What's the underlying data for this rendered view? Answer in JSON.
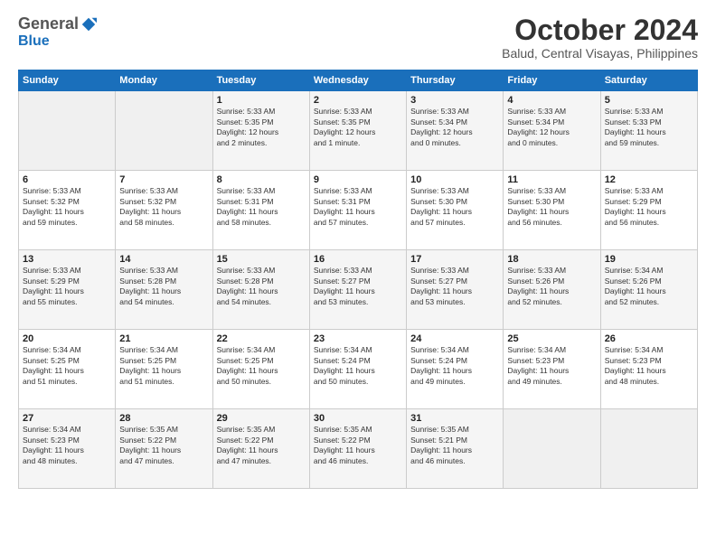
{
  "logo": {
    "general": "General",
    "blue": "Blue"
  },
  "title": "October 2024",
  "location": "Balud, Central Visayas, Philippines",
  "days_of_week": [
    "Sunday",
    "Monday",
    "Tuesday",
    "Wednesday",
    "Thursday",
    "Friday",
    "Saturday"
  ],
  "weeks": [
    [
      {
        "day": "",
        "info": ""
      },
      {
        "day": "",
        "info": ""
      },
      {
        "day": "1",
        "info": "Sunrise: 5:33 AM\nSunset: 5:35 PM\nDaylight: 12 hours\nand 2 minutes."
      },
      {
        "day": "2",
        "info": "Sunrise: 5:33 AM\nSunset: 5:35 PM\nDaylight: 12 hours\nand 1 minute."
      },
      {
        "day": "3",
        "info": "Sunrise: 5:33 AM\nSunset: 5:34 PM\nDaylight: 12 hours\nand 0 minutes."
      },
      {
        "day": "4",
        "info": "Sunrise: 5:33 AM\nSunset: 5:34 PM\nDaylight: 12 hours\nand 0 minutes."
      },
      {
        "day": "5",
        "info": "Sunrise: 5:33 AM\nSunset: 5:33 PM\nDaylight: 11 hours\nand 59 minutes."
      }
    ],
    [
      {
        "day": "6",
        "info": "Sunrise: 5:33 AM\nSunset: 5:32 PM\nDaylight: 11 hours\nand 59 minutes."
      },
      {
        "day": "7",
        "info": "Sunrise: 5:33 AM\nSunset: 5:32 PM\nDaylight: 11 hours\nand 58 minutes."
      },
      {
        "day": "8",
        "info": "Sunrise: 5:33 AM\nSunset: 5:31 PM\nDaylight: 11 hours\nand 58 minutes."
      },
      {
        "day": "9",
        "info": "Sunrise: 5:33 AM\nSunset: 5:31 PM\nDaylight: 11 hours\nand 57 minutes."
      },
      {
        "day": "10",
        "info": "Sunrise: 5:33 AM\nSunset: 5:30 PM\nDaylight: 11 hours\nand 57 minutes."
      },
      {
        "day": "11",
        "info": "Sunrise: 5:33 AM\nSunset: 5:30 PM\nDaylight: 11 hours\nand 56 minutes."
      },
      {
        "day": "12",
        "info": "Sunrise: 5:33 AM\nSunset: 5:29 PM\nDaylight: 11 hours\nand 56 minutes."
      }
    ],
    [
      {
        "day": "13",
        "info": "Sunrise: 5:33 AM\nSunset: 5:29 PM\nDaylight: 11 hours\nand 55 minutes."
      },
      {
        "day": "14",
        "info": "Sunrise: 5:33 AM\nSunset: 5:28 PM\nDaylight: 11 hours\nand 54 minutes."
      },
      {
        "day": "15",
        "info": "Sunrise: 5:33 AM\nSunset: 5:28 PM\nDaylight: 11 hours\nand 54 minutes."
      },
      {
        "day": "16",
        "info": "Sunrise: 5:33 AM\nSunset: 5:27 PM\nDaylight: 11 hours\nand 53 minutes."
      },
      {
        "day": "17",
        "info": "Sunrise: 5:33 AM\nSunset: 5:27 PM\nDaylight: 11 hours\nand 53 minutes."
      },
      {
        "day": "18",
        "info": "Sunrise: 5:33 AM\nSunset: 5:26 PM\nDaylight: 11 hours\nand 52 minutes."
      },
      {
        "day": "19",
        "info": "Sunrise: 5:34 AM\nSunset: 5:26 PM\nDaylight: 11 hours\nand 52 minutes."
      }
    ],
    [
      {
        "day": "20",
        "info": "Sunrise: 5:34 AM\nSunset: 5:25 PM\nDaylight: 11 hours\nand 51 minutes."
      },
      {
        "day": "21",
        "info": "Sunrise: 5:34 AM\nSunset: 5:25 PM\nDaylight: 11 hours\nand 51 minutes."
      },
      {
        "day": "22",
        "info": "Sunrise: 5:34 AM\nSunset: 5:25 PM\nDaylight: 11 hours\nand 50 minutes."
      },
      {
        "day": "23",
        "info": "Sunrise: 5:34 AM\nSunset: 5:24 PM\nDaylight: 11 hours\nand 50 minutes."
      },
      {
        "day": "24",
        "info": "Sunrise: 5:34 AM\nSunset: 5:24 PM\nDaylight: 11 hours\nand 49 minutes."
      },
      {
        "day": "25",
        "info": "Sunrise: 5:34 AM\nSunset: 5:23 PM\nDaylight: 11 hours\nand 49 minutes."
      },
      {
        "day": "26",
        "info": "Sunrise: 5:34 AM\nSunset: 5:23 PM\nDaylight: 11 hours\nand 48 minutes."
      }
    ],
    [
      {
        "day": "27",
        "info": "Sunrise: 5:34 AM\nSunset: 5:23 PM\nDaylight: 11 hours\nand 48 minutes."
      },
      {
        "day": "28",
        "info": "Sunrise: 5:35 AM\nSunset: 5:22 PM\nDaylight: 11 hours\nand 47 minutes."
      },
      {
        "day": "29",
        "info": "Sunrise: 5:35 AM\nSunset: 5:22 PM\nDaylight: 11 hours\nand 47 minutes."
      },
      {
        "day": "30",
        "info": "Sunrise: 5:35 AM\nSunset: 5:22 PM\nDaylight: 11 hours\nand 46 minutes."
      },
      {
        "day": "31",
        "info": "Sunrise: 5:35 AM\nSunset: 5:21 PM\nDaylight: 11 hours\nand 46 minutes."
      },
      {
        "day": "",
        "info": ""
      },
      {
        "day": "",
        "info": ""
      }
    ]
  ]
}
